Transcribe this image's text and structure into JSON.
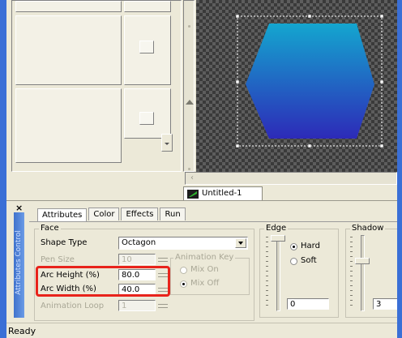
{
  "document_tab": {
    "label": "Untitled-1"
  },
  "panel": {
    "close_glyph": "×",
    "side_title": "Attributes Control",
    "tabs": [
      {
        "label": "Attributes"
      },
      {
        "label": "Color"
      },
      {
        "label": "Effects"
      },
      {
        "label": "Run"
      }
    ],
    "face": {
      "title": "Face",
      "shape_type_label": "Shape Type",
      "shape_type_value": "Octagon",
      "pen_size_label": "Pen Size",
      "pen_size_value": "10",
      "arc_height_label": "Arc Height (%)",
      "arc_height_value": "80.0",
      "arc_width_label": "Arc Width (%)",
      "arc_width_value": "40.0",
      "animation_loop_label": "Animation Loop",
      "animation_loop_value": "1"
    },
    "animation_key": {
      "title": "Animation Key",
      "options": [
        {
          "label": "Mix On",
          "selected": false
        },
        {
          "label": "Mix Off",
          "selected": true
        }
      ]
    },
    "edge": {
      "title": "Edge",
      "options": [
        {
          "label": "Hard",
          "selected": true
        },
        {
          "label": "Soft",
          "selected": false
        }
      ],
      "value": "0"
    },
    "shadow": {
      "title": "Shadow",
      "value": "3"
    }
  },
  "status_bar": {
    "text": "Ready"
  },
  "colors": {
    "shape_gradient_top": "#14a6cf",
    "shape_gradient_bottom": "#2d2ab8",
    "highlight": "#e8231b"
  }
}
